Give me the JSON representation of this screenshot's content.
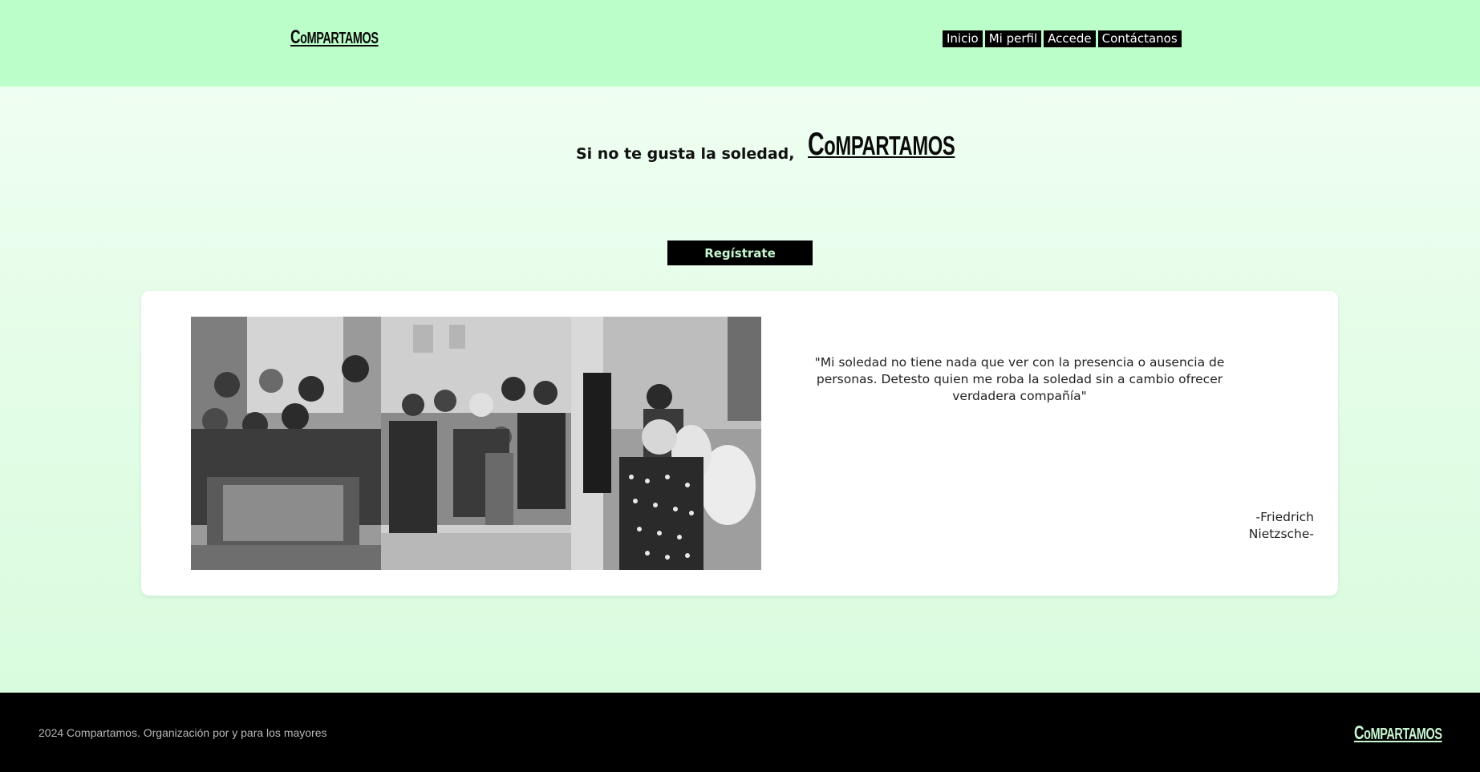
{
  "header": {
    "logo": {
      "first": "C",
      "second": "o",
      "rest": "MPARTAMOS"
    },
    "nav": [
      "Inicio",
      "Mi perfil",
      "Accede",
      "Contáctanos"
    ]
  },
  "hero": {
    "tagline": "Si no te gusta la soledad,",
    "logo": {
      "first": "C",
      "second": "o",
      "rest": "MPARTAMOS"
    },
    "register_label": "Regístrate"
  },
  "card": {
    "quote": "\"Mi soledad no tiene nada que ver con la presencia o ausencia de personas. Detesto quien me roba la soledad sin a cambio ofrecer verdadera compañía\"",
    "author_line1": "-Friedrich",
    "author_line2": "Nietzsche-"
  },
  "footer": {
    "copyright": "2024 Compartamos. Organización por y para los mayores",
    "logo": {
      "first": "C",
      "second": "o",
      "rest": "MPARTAMOS"
    }
  },
  "colors": {
    "header_bg": "#bcfec9",
    "accent_green": "#c8f7d2",
    "footer_bg": "#000000"
  }
}
